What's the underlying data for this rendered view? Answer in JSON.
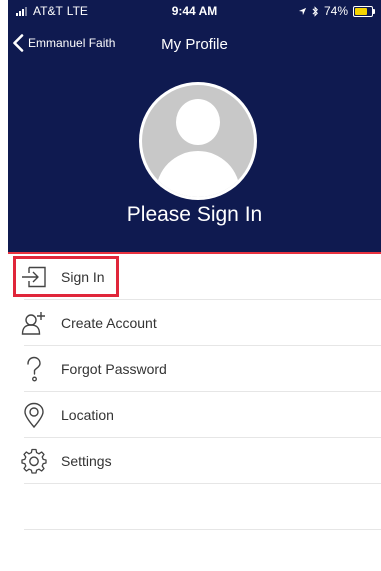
{
  "status_bar": {
    "carrier": "AT&T",
    "network": "LTE",
    "time": "9:44 AM",
    "battery": "74%",
    "battery_level": 0.74
  },
  "nav": {
    "back_label": "Emmanuel Faith",
    "title": "My Profile"
  },
  "profile": {
    "prompt": "Please Sign In"
  },
  "menu": {
    "items": [
      {
        "label": "Sign In",
        "icon": "sign-in-icon"
      },
      {
        "label": "Create Account",
        "icon": "add-user-icon"
      },
      {
        "label": "Forgot Password",
        "icon": "question-icon"
      },
      {
        "label": "Location",
        "icon": "location-pin-icon"
      },
      {
        "label": "Settings",
        "icon": "gear-icon"
      }
    ]
  },
  "colors": {
    "header_bg": "#0f1a50",
    "accent_line": "#e8323f",
    "highlight_border": "#e0263a"
  }
}
